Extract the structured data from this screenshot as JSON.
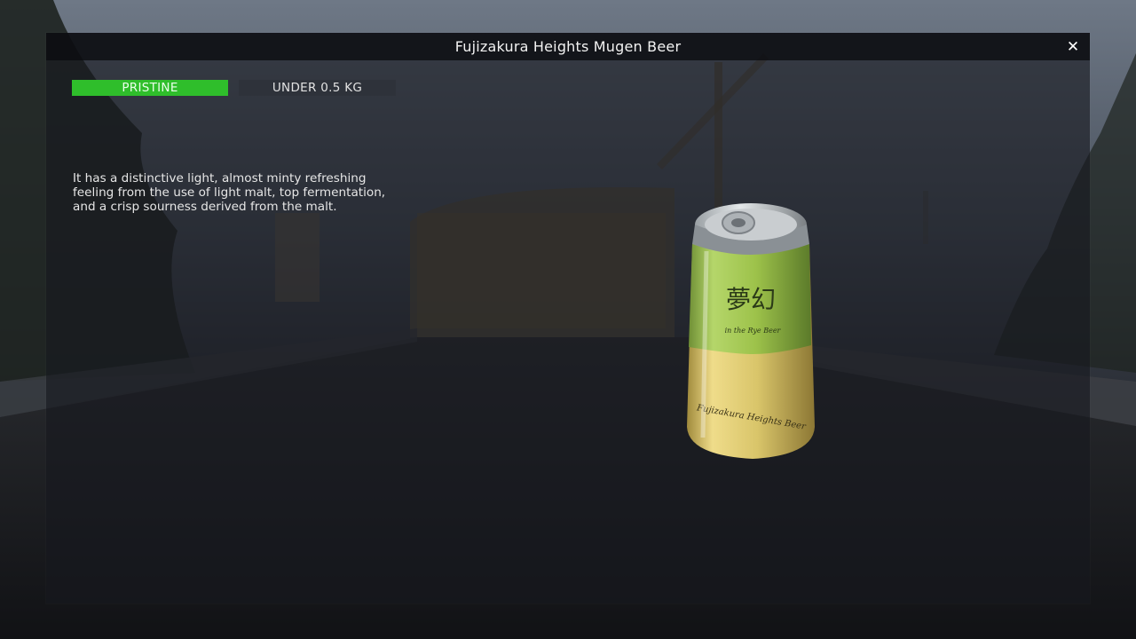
{
  "window": {
    "title": "Fujizakura Heights Mugen Beer",
    "close_symbol": "✕"
  },
  "tags": {
    "condition": "PRISTINE",
    "weight": "UNDER 0.5 KG"
  },
  "item": {
    "description": "It has a distinctive light, almost minty refreshing feeling from the use of light malt, top fermentation, and a crisp sourness derived from the malt.",
    "can_label_kanji": "夢幻",
    "can_label_script": "in the Rye Beer",
    "can_label_brand": "Fujizakura Heights Beer"
  },
  "colors": {
    "condition_tag": "#2fbe2b",
    "weight_tag": "#2e323a",
    "can_green": "#9dc24a",
    "can_yellow": "#d9c56a"
  },
  "icons": {
    "close": "close-icon"
  }
}
